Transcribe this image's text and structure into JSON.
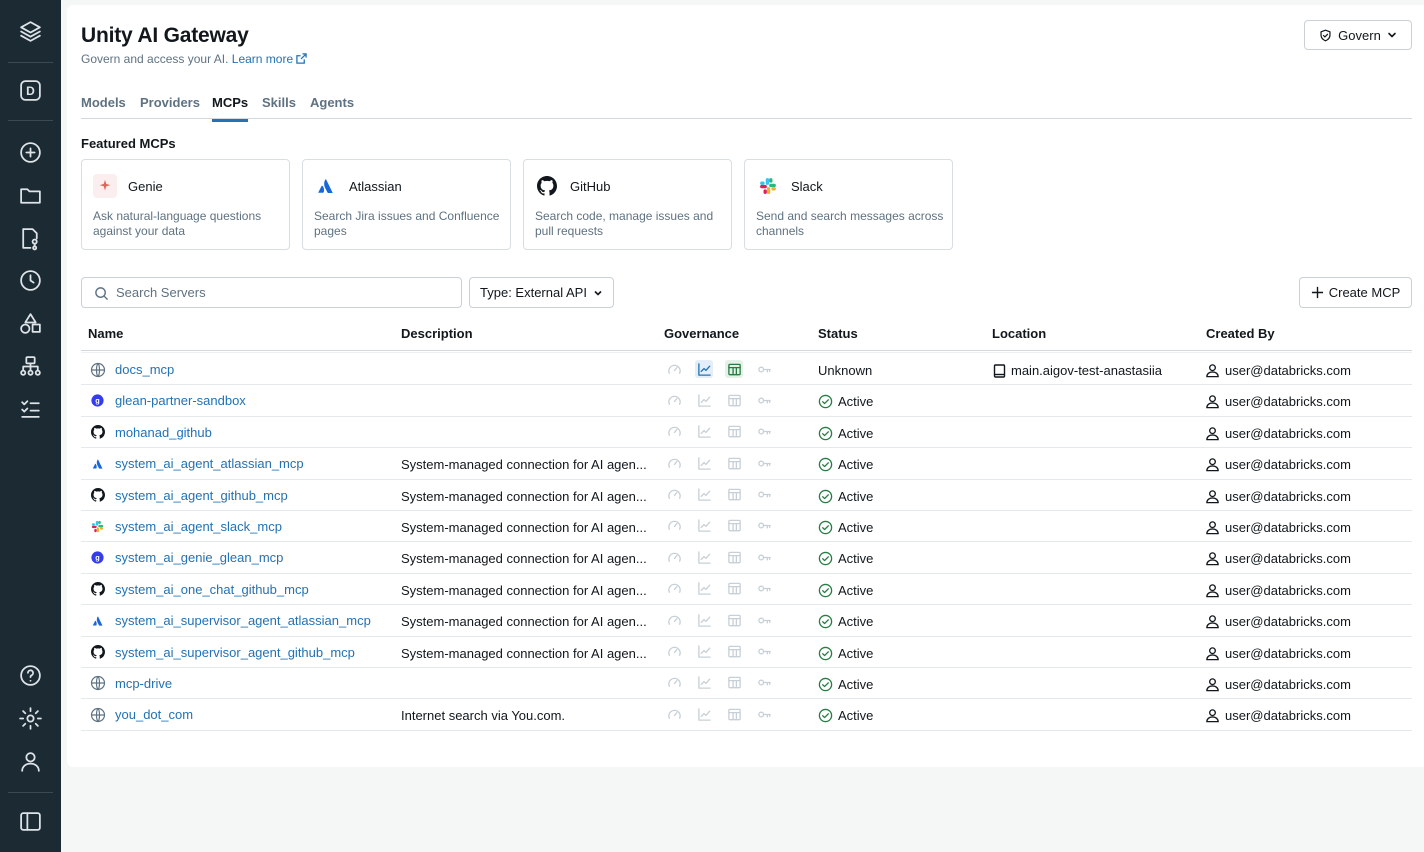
{
  "app": {
    "title": "Unity AI Gateway",
    "subtitle": "Govern and access your AI.",
    "learn_more": "Learn more",
    "govern_button": "Govern",
    "workspace_initial": "D"
  },
  "tabs": [
    {
      "label": "Models",
      "active": false
    },
    {
      "label": "Providers",
      "active": false
    },
    {
      "label": "MCPs",
      "active": true
    },
    {
      "label": "Skills",
      "active": false
    },
    {
      "label": "Agents",
      "active": false
    }
  ],
  "featured": {
    "title": "Featured MCPs",
    "cards": [
      {
        "name": "Genie",
        "description": "Ask natural-language questions against your data",
        "icon": "genie-icon"
      },
      {
        "name": "Atlassian",
        "description": "Search Jira issues and Confluence pages",
        "icon": "atlassian-icon"
      },
      {
        "name": "GitHub",
        "description": "Search code, manage issues and pull requests",
        "icon": "github-icon"
      },
      {
        "name": "Slack",
        "description": "Send and search messages across channels",
        "icon": "slack-icon"
      }
    ]
  },
  "toolbar": {
    "search_placeholder": "Search Servers",
    "type_filter": "Type: External API",
    "create_label": "Create MCP"
  },
  "table": {
    "columns": [
      "Name",
      "Description",
      "Governance",
      "Status",
      "Location",
      "Created By"
    ],
    "rows": [
      {
        "name": "docs_mcp",
        "icon": "globe",
        "description": "",
        "status": "Unknown",
        "location": "main.aigov-test-anastasiia",
        "created_by": "user@databricks.com",
        "gov_active": true
      },
      {
        "name": "glean-partner-sandbox",
        "icon": "glean",
        "description": "",
        "status": "Active",
        "location": "",
        "created_by": "user@databricks.com"
      },
      {
        "name": "mohanad_github",
        "icon": "github",
        "description": "",
        "status": "Active",
        "location": "",
        "created_by": "user@databricks.com"
      },
      {
        "name": "system_ai_agent_atlassian_mcp",
        "icon": "atlassian",
        "description": "System-managed connection for AI agen...",
        "status": "Active",
        "location": "",
        "created_by": "user@databricks.com"
      },
      {
        "name": "system_ai_agent_github_mcp",
        "icon": "github",
        "description": "System-managed connection for AI agen...",
        "status": "Active",
        "location": "",
        "created_by": "user@databricks.com"
      },
      {
        "name": "system_ai_agent_slack_mcp",
        "icon": "slack",
        "description": "System-managed connection for AI agen...",
        "status": "Active",
        "location": "",
        "created_by": "user@databricks.com"
      },
      {
        "name": "system_ai_genie_glean_mcp",
        "icon": "glean",
        "description": "System-managed connection for AI agen...",
        "status": "Active",
        "location": "",
        "created_by": "user@databricks.com"
      },
      {
        "name": "system_ai_one_chat_github_mcp",
        "icon": "github",
        "description": "System-managed connection for AI agen...",
        "status": "Active",
        "location": "",
        "created_by": "user@databricks.com"
      },
      {
        "name": "system_ai_supervisor_agent_atlassian_mcp",
        "icon": "atlassian",
        "description": "System-managed connection for AI agen...",
        "status": "Active",
        "location": "",
        "created_by": "user@databricks.com"
      },
      {
        "name": "system_ai_supervisor_agent_github_mcp",
        "icon": "github",
        "description": "System-managed connection for AI agen...",
        "status": "Active",
        "location": "",
        "created_by": "user@databricks.com"
      },
      {
        "name": "mcp-drive",
        "icon": "globe",
        "description": "",
        "status": "Active",
        "location": "",
        "created_by": "user@databricks.com"
      },
      {
        "name": "you_dot_com",
        "icon": "globe",
        "description": "Internet search via You.com.",
        "status": "Active",
        "location": "",
        "created_by": "user@databricks.com"
      }
    ]
  },
  "colors": {
    "rail": "#1b2a33",
    "link": "#2272b4",
    "active_status": "#277c43"
  }
}
